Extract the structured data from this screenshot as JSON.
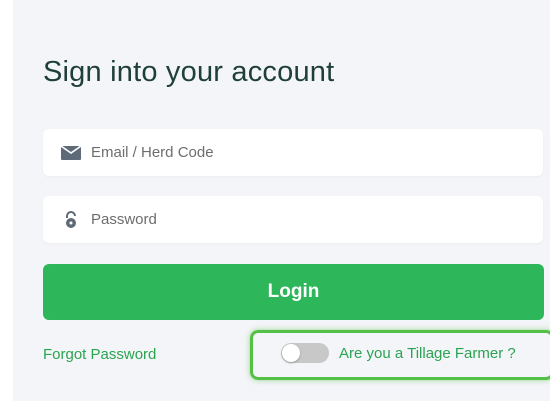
{
  "form": {
    "title": "Sign into your account",
    "email": {
      "placeholder": "Email / Herd Code",
      "value": "",
      "icon": "envelope-icon"
    },
    "password": {
      "placeholder": "Password",
      "value": "",
      "icon": "lock-icon"
    },
    "login_label": "Login",
    "forgot_label": "Forgot Password",
    "tillage_toggle": {
      "label": "Are you a Tillage Farmer ?",
      "checked": false
    }
  },
  "colors": {
    "background": "#f4f5f8",
    "title": "#1f3f3a",
    "accent": "#2db65a",
    "link": "#2aa351",
    "highlight": "#54c046"
  }
}
